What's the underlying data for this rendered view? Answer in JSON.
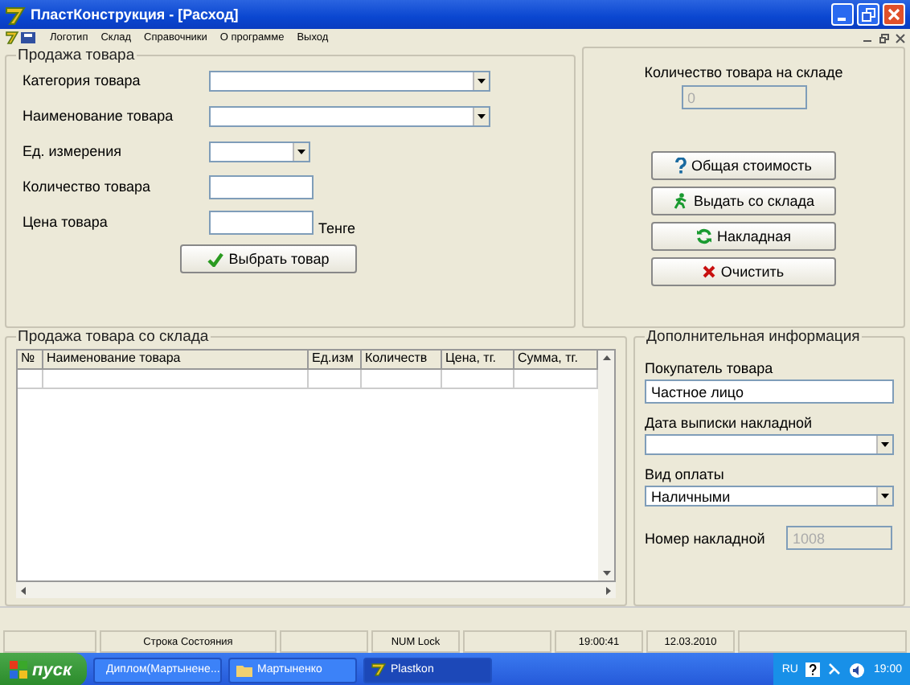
{
  "window": {
    "title": "ПластКонструкция - [Расход]"
  },
  "menu": [
    "Логотип",
    "Склад",
    "Справочники",
    "О программе",
    "Выход"
  ],
  "sale_form": {
    "title": "Продажа товара",
    "fields": [
      {
        "label": "Категория товара",
        "kind": "combo"
      },
      {
        "label": "Наименование товара",
        "kind": "combo"
      },
      {
        "label": "Ед. измерения",
        "kind": "short_combo"
      },
      {
        "label": "Количество товара",
        "kind": "text"
      },
      {
        "label": "Цена товара",
        "kind": "text",
        "suffix": "Тенге"
      }
    ],
    "button": "Выбрать товар"
  },
  "stock": {
    "label": "Количество товара на складе",
    "value": "0",
    "disabled": true,
    "buttons": [
      "Общая стоимость",
      "Выдать со склада",
      "Накладная",
      "Очистить"
    ]
  },
  "table": {
    "title": "Продажа товара со склада",
    "columns": [
      "№",
      "Наименование товара",
      "Ед.изм",
      "Количеств",
      "Цена, тг.",
      "Сумма, тг."
    ]
  },
  "extra": {
    "title": "Дополнительная информация",
    "fields": [
      {
        "label": "Покупатель товара",
        "kind": "text",
        "value": "Частное лицо",
        "disabled": false
      },
      {
        "label": "Дата выписки накладной",
        "kind": "combo",
        "disabled": false
      },
      {
        "label": "Вид оплаты",
        "kind": "combo",
        "value": "Наличными",
        "disabled": false
      },
      {
        "label": "Номер накладной",
        "kind": "inline",
        "value": "1008",
        "disabled": true
      }
    ]
  },
  "status_bar": [
    "Строка Состояния",
    "NUM Lock",
    "19:00:41",
    "12.03.2010"
  ],
  "taskbar": {
    "start": "пуск",
    "tasks": [
      {
        "label": "Диплом(Мартынене...",
        "selected": false
      },
      {
        "label": "Мартыненко",
        "selected": false
      },
      {
        "label": "Plastkon",
        "selected": true
      }
    ],
    "tray": {
      "lang": "RU",
      "time": "19:00"
    }
  }
}
